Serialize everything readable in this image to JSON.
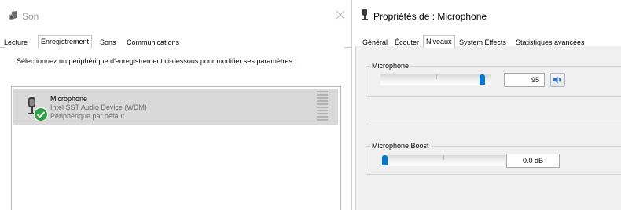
{
  "son_window": {
    "title": "Son",
    "tabs": [
      {
        "label": "Lecture",
        "active": false
      },
      {
        "label": "Enregistrement",
        "active": true
      },
      {
        "label": "Sons",
        "active": false
      },
      {
        "label": "Communications",
        "active": false
      }
    ],
    "instruction": "Sélectionnez un périphérique d'enregistrement ci-dessous pour modifier ses paramètres :",
    "devices": [
      {
        "name": "Microphone",
        "driver": "Intel SST Audio Device (WDM)",
        "status": "Périphérique par défaut",
        "icon": "microphone-icon",
        "badge": "default-check-icon",
        "selected": true
      }
    ]
  },
  "props_window": {
    "title": "Propriétés de : Microphone",
    "tabs": [
      {
        "label": "Général",
        "active": false
      },
      {
        "label": "Écouter",
        "active": false
      },
      {
        "label": "Niveaux",
        "active": true
      },
      {
        "label": "System Effects",
        "active": false
      },
      {
        "label": "Statistiques avancées",
        "active": false
      }
    ],
    "microphone": {
      "label": "Microphone",
      "value": "95",
      "level": 0.95,
      "speaker_icon": "speaker-icon"
    },
    "boost": {
      "label": "Microphone Boost",
      "value": "0.0 dB",
      "level": 0.0
    }
  },
  "colors": {
    "accent": "#0078d7",
    "selected_row": "#d9d9d9",
    "check_badge": "#2f9e45",
    "panel": "#f0f0f0"
  }
}
